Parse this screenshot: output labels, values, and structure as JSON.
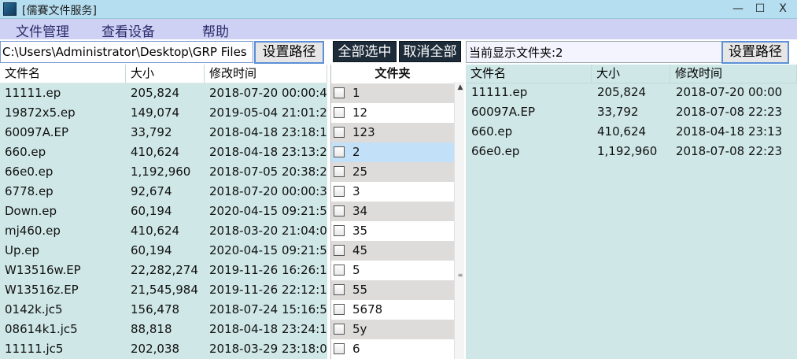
{
  "window": {
    "title": "[儒賽文件服务]",
    "min_glyph": "—",
    "max_glyph": "☐",
    "close_glyph": "X"
  },
  "menu": [
    "文件管理",
    "查看设备",
    "帮助"
  ],
  "left": {
    "path_value": "C:\\Users\\Administrator\\Desktop\\GRP Files",
    "set_path_label": "设置路径",
    "columns": [
      "文件名",
      "大小",
      "修改时间"
    ],
    "files": [
      {
        "name": "11111.ep",
        "size": "205,824",
        "time": "2018-07-20  00:00:4"
      },
      {
        "name": "19872x5.ep",
        "size": "149,074",
        "time": "2019-05-04  21:01:2"
      },
      {
        "name": "60097A.EP",
        "size": "33,792",
        "time": "2018-04-18  23:18:1"
      },
      {
        "name": "660.ep",
        "size": "410,624",
        "time": "2018-04-18  23:13:2"
      },
      {
        "name": "66e0.ep",
        "size": "1,192,960",
        "time": "2018-07-05  20:38:2"
      },
      {
        "name": "6778.ep",
        "size": "92,674",
        "time": "2018-07-20  00:00:3"
      },
      {
        "name": "Down.ep",
        "size": "60,194",
        "time": "2020-04-15  09:21:5"
      },
      {
        "name": "mj460.ep",
        "size": "410,624",
        "time": "2018-03-20  21:04:0"
      },
      {
        "name": "Up.ep",
        "size": "60,194",
        "time": "2020-04-15  09:21:5"
      },
      {
        "name": "W13516w.EP",
        "size": "22,282,274",
        "time": "2019-11-26  16:26:1"
      },
      {
        "name": "W13516z.EP",
        "size": "21,545,984",
        "time": "2019-11-26  22:12:1"
      },
      {
        "name": "0142k.jc5",
        "size": "156,478",
        "time": "2018-07-24  15:16:5"
      },
      {
        "name": "08614k1.jc5",
        "size": "88,818",
        "time": "2018-04-18  23:24:1"
      },
      {
        "name": "11111.jc5",
        "size": "202,038",
        "time": "2018-03-29  23:18:0"
      }
    ]
  },
  "middle": {
    "select_all_label": "全部选中",
    "deselect_all_label": "取消全部",
    "folder_header": "文件夹",
    "folders": [
      "1",
      "12",
      "123",
      "2",
      "25",
      "3",
      "34",
      "35",
      "45",
      "5",
      "55",
      "5678",
      "5y",
      "6"
    ],
    "selected_folder": "2",
    "scroll_up_glyph": "▲",
    "scroll_grip_glyph": "≡"
  },
  "right": {
    "current_folder_text": "当前显示文件夹:2",
    "set_path_label": "设置路径",
    "columns": [
      "文件名",
      "大小",
      "修改时间"
    ],
    "files": [
      {
        "name": "11111.ep",
        "size": "205,824",
        "time": "2018-07-20  00:00"
      },
      {
        "name": "60097A.EP",
        "size": "33,792",
        "time": "2018-07-08  22:23"
      },
      {
        "name": "660.ep",
        "size": "410,624",
        "time": "2018-04-18  23:13"
      },
      {
        "name": "66e0.ep",
        "size": "1,192,960",
        "time": "2018-07-08  22:23"
      }
    ]
  }
}
